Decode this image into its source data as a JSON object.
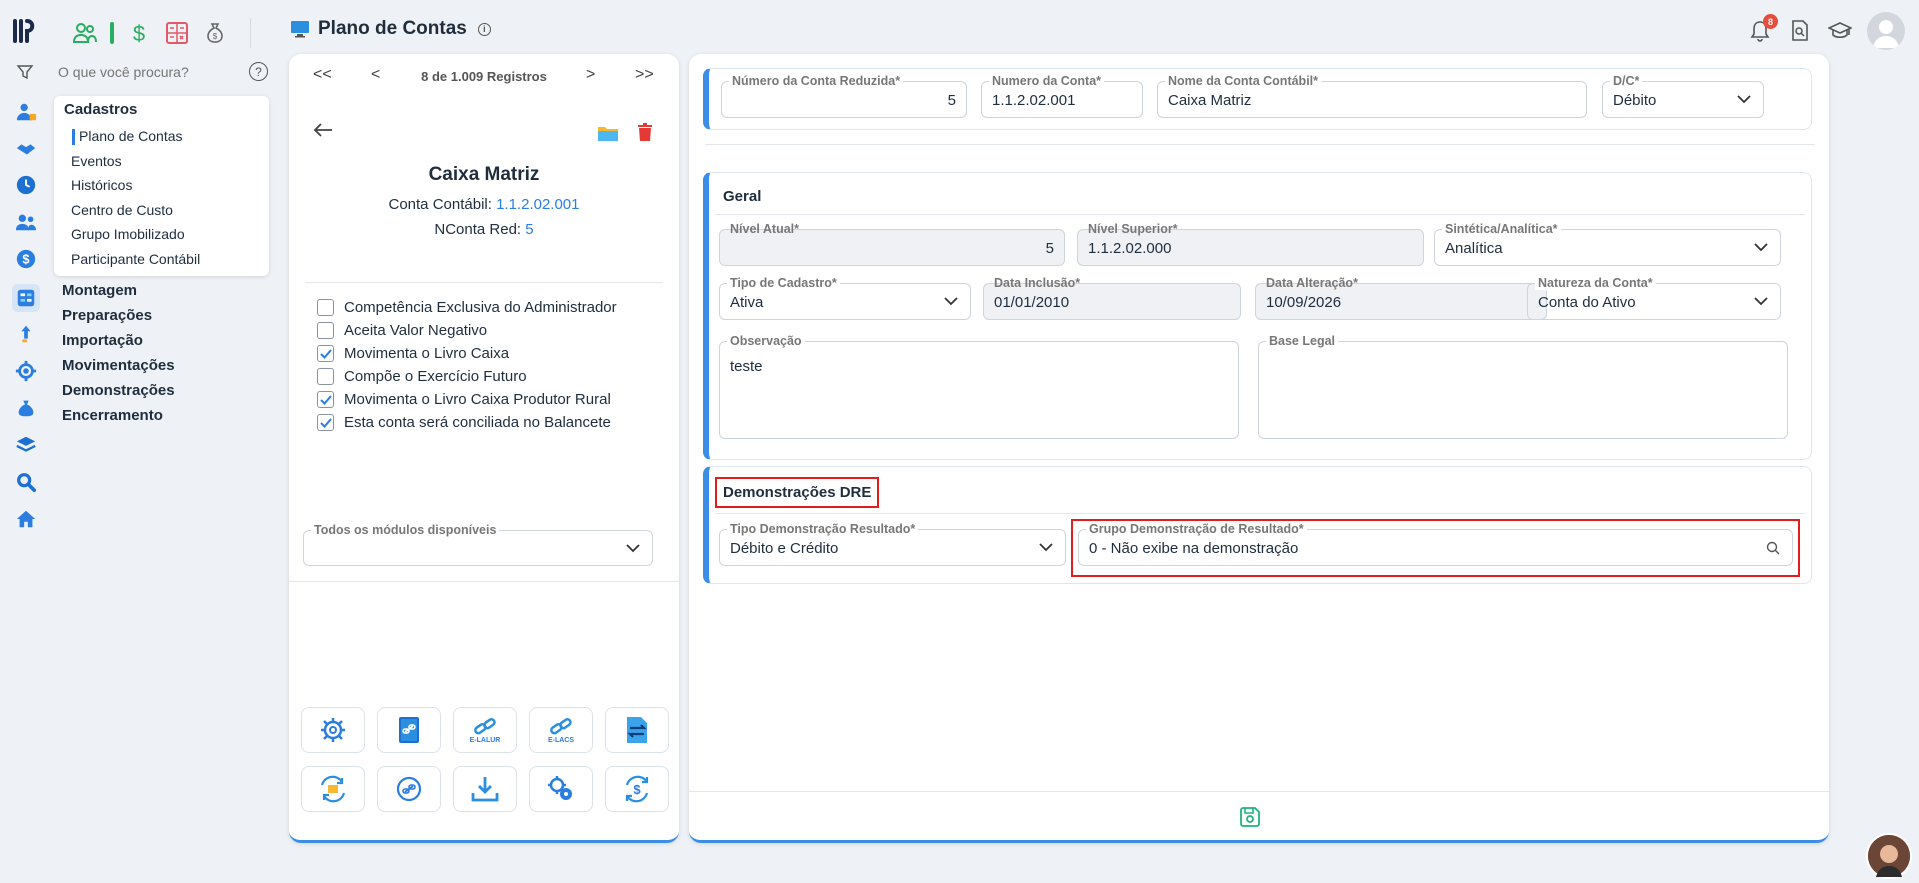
{
  "app": {
    "title": "Plano de Contas",
    "search_placeholder": "O que você procura?",
    "notification_count": "8",
    "accent": "#2b7de0"
  },
  "menu": {
    "section": "Cadastros",
    "sub_items": [
      "Plano de Contas",
      "Eventos",
      "Históricos",
      "Centro de Custo",
      "Grupo Imobilizado",
      "Participante Contábil"
    ],
    "main_items": [
      "Montagem",
      "Preparações",
      "Importação",
      "Movimentações",
      "Demonstrações",
      "Encerramento"
    ]
  },
  "record": {
    "pager_text": "8 de 1.009 Registros",
    "name": "Caixa Matriz",
    "conta_label": "Conta Contábil:",
    "conta_value": "1.1.2.02.001",
    "nconta_label": "NConta Red:",
    "nconta_value": "5",
    "checkboxes": [
      {
        "label": "Competência Exclusiva do Administrador",
        "checked": false
      },
      {
        "label": "Aceita Valor Negativo",
        "checked": false
      },
      {
        "label": "Movimenta o Livro Caixa",
        "checked": true
      },
      {
        "label": "Compõe o Exercício Futuro",
        "checked": false
      },
      {
        "label": "Movimenta o Livro Caixa Produtor Rural",
        "checked": true
      },
      {
        "label": "Esta conta será conciliada no Balancete",
        "checked": true
      }
    ],
    "modules_label": "Todos os módulos disponíveis",
    "modules_value": "",
    "tile_captions": {
      "elalur": "E-LALUR",
      "elacs": "E-LACS"
    }
  },
  "header_fields": {
    "reduzida_label": "Número da Conta Reduzida*",
    "reduzida_value": "5",
    "numero_label": "Numero da Conta*",
    "numero_value": "1.1.2.02.001",
    "nome_label": "Nome da Conta Contábil*",
    "nome_value": "Caixa Matriz",
    "dc_label": "D/C*",
    "dc_value": "Débito"
  },
  "geral": {
    "title": "Geral",
    "nivel_atual_label": "Nível Atual*",
    "nivel_atual_value": "5",
    "nivel_superior_label": "Nível Superior*",
    "nivel_superior_value": "1.1.2.02.000",
    "sintetica_label": "Sintética/Analítica*",
    "sintetica_value": "Analítica",
    "tipo_cadastro_label": "Tipo de Cadastro*",
    "tipo_cadastro_value": "Ativa",
    "data_inclusao_label": "Data Inclusão*",
    "data_inclusao_value": "01/01/2010",
    "data_alteracao_label": "Data Alteração*",
    "data_alteracao_value": "10/09/2026",
    "natureza_label": "Natureza da Conta*",
    "natureza_value": "Conta do Ativo",
    "observacao_label": "Observação",
    "observacao_value": "teste",
    "base_legal_label": "Base Legal",
    "base_legal_value": ""
  },
  "dre": {
    "title": "Demonstrações DRE",
    "tipo_label": "Tipo Demonstração Resultado*",
    "tipo_value": "Débito e Crédito",
    "grupo_label": "Grupo Demonstração de Resultado*",
    "grupo_value": "0 - Não exibe na demonstração"
  }
}
